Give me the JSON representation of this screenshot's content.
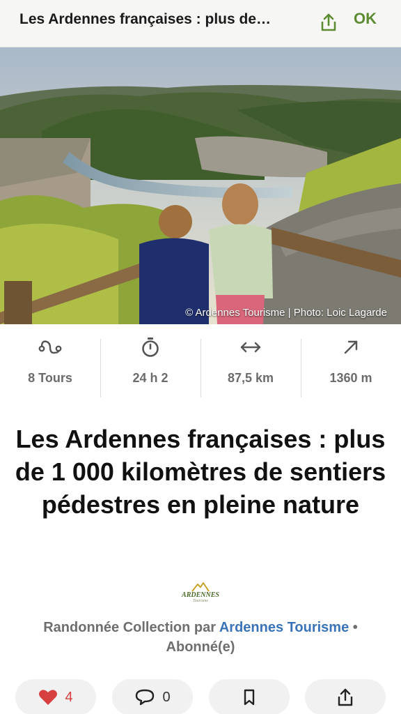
{
  "header": {
    "title": "Les Ardennes françaises : plus de…",
    "ok_label": "OK"
  },
  "hero": {
    "credit": "© Ardennes Tourisme | Photo: Loic Lagarde"
  },
  "stats": [
    {
      "icon": "route-icon",
      "value": "8 Tours"
    },
    {
      "icon": "stopwatch-icon",
      "value": "24 h 2"
    },
    {
      "icon": "distance-arrows-icon",
      "value": "87,5 km"
    },
    {
      "icon": "elevation-arrow-icon",
      "value": "1360 m"
    }
  ],
  "headline": "Les Ardennes françaises : plus de 1 000 kilomètres de sentiers pédestres en pleine nature",
  "logo": {
    "text": "ARDENNES",
    "sub": "Tourisme"
  },
  "byline": {
    "prefix": "Randonnée Collection par ",
    "author": "Ardennes Tourisme",
    "separator": " • ",
    "status": "Abonné(e)"
  },
  "actions": {
    "likes": "4",
    "comments": "0"
  },
  "colors": {
    "accent_green": "#5c8c2f",
    "link_blue": "#3a73b8",
    "heart_red": "#d6403f"
  }
}
